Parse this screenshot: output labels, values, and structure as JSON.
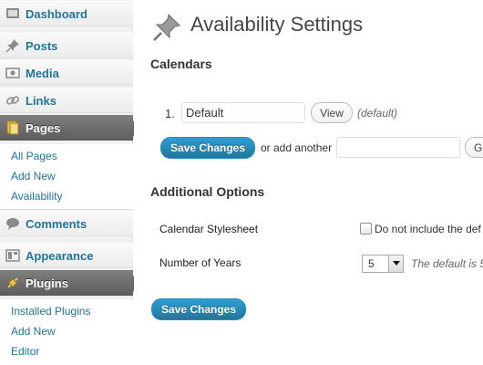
{
  "sidebar": {
    "items": [
      {
        "label": "Dashboard",
        "icon": "dashboard-icon"
      },
      {
        "label": "Posts",
        "icon": "pushpin-icon"
      },
      {
        "label": "Media",
        "icon": "media-icon"
      },
      {
        "label": "Links",
        "icon": "link-icon"
      },
      {
        "label": "Pages",
        "icon": "pages-icon",
        "current": true
      },
      {
        "label": "Comments",
        "icon": "comment-icon"
      },
      {
        "label": "Appearance",
        "icon": "appearance-icon"
      },
      {
        "label": "Plugins",
        "icon": "plugin-icon",
        "current": true
      }
    ],
    "pages_submenu": [
      "All Pages",
      "Add New",
      "Availability"
    ],
    "plugins_submenu": [
      "Installed Plugins",
      "Add New",
      "Editor"
    ]
  },
  "main": {
    "title": "Availability Settings",
    "calendars_heading": "Calendars",
    "calendar_row": {
      "number": "1.",
      "name_value": "Default",
      "view_label": "View",
      "default_note": "(default)"
    },
    "save_label": "Save Changes",
    "add_another_text": "or add another",
    "add_another_value": "",
    "go_label": "G",
    "additional_heading": "Additional Options",
    "stylesheet_label": "Calendar Stylesheet",
    "stylesheet_checkbox_text": "Do not include the def",
    "stylesheet_checked": false,
    "years_label": "Number of Years",
    "years_value": "5",
    "years_note": "The default is 5",
    "save_label_2": "Save Changes"
  },
  "colors": {
    "link": "#21759b",
    "primary_button": "#21759b",
    "current_menu": "#6d6d6d"
  }
}
